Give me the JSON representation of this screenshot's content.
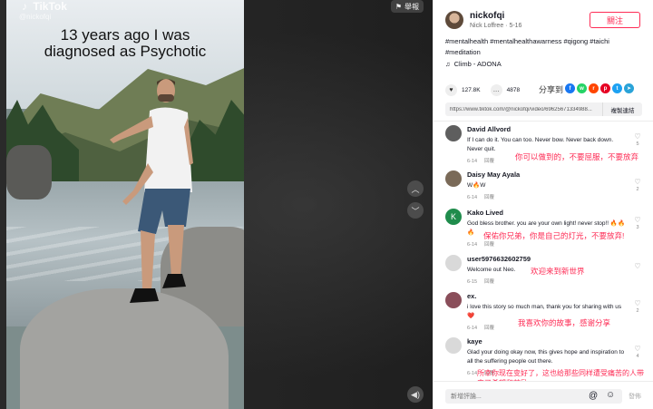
{
  "video": {
    "brand": "TikTok",
    "handle": "@nickofqi",
    "caption_line1": "13 years ago I was",
    "caption_line2": "diagnosed as Psychotic",
    "report_label": "舉報"
  },
  "author": {
    "username": "nickofqi",
    "meta": "Nick Loffree · 5-16",
    "follow_label": "關注"
  },
  "description": {
    "hashtags": "#mentalhealth #mentalhealthawarness #qigong #taichi #meditation",
    "music": "Climb - ADONA"
  },
  "stats": {
    "likes": "127.8K",
    "comments": "4878"
  },
  "share": {
    "label": "分享到",
    "icons": [
      "facebook",
      "whatsapp",
      "reddit",
      "pinterest",
      "twitter",
      "telegram"
    ],
    "link": "https://www.tiktok.com/@nickofqi/video/69625671334988...",
    "copy_label": "複製連結"
  },
  "comments": [
    {
      "name": "David Allvord",
      "text": "If I can do it. You can too. Never bow. Never back down. Never quit.",
      "date": "6-14",
      "reply": "回覆",
      "likes": "5",
      "translation": "你可以做到的，不要屈服，不要放弃"
    },
    {
      "name": "Daisy May Ayala",
      "text": "W🔥W",
      "date": "6-14",
      "reply": "回覆",
      "likes": "2",
      "translation": ""
    },
    {
      "name": "Kako Lived",
      "text": "God bless brother. you are your own light! never stop!! 🔥🔥🔥",
      "date": "6-14",
      "reply": "回覆",
      "likes": "3",
      "translation": "保佑你兄弟，你是自己的灯光，不要放弃!"
    },
    {
      "name": "user5976632602759",
      "text": "Welcome out Neo.",
      "date": "6-15",
      "reply": "回覆",
      "likes": "",
      "translation": "欢迎来到新世界"
    },
    {
      "name": "ex.",
      "text": "i love this story so much man, thank you for sharing with us ❤️",
      "date": "6-14",
      "reply": "回覆",
      "likes": "2",
      "translation": "我喜欢你的故事，感谢分享"
    },
    {
      "name": "kaye",
      "text": "Glad your doing okay now, this gives hope and inspiration to all the suffering people out there.",
      "date": "6-14",
      "reply": "回覆",
      "likes": "4",
      "translation": "所幸你现在变好了，这也给那些同样遭受痛苦的人带来了希望和鼓励"
    }
  ],
  "footer": {
    "input_placeholder": "新增評論...",
    "post_label": "發佈"
  },
  "colors": {
    "accent": "#fe2c55",
    "text": "#161823"
  }
}
